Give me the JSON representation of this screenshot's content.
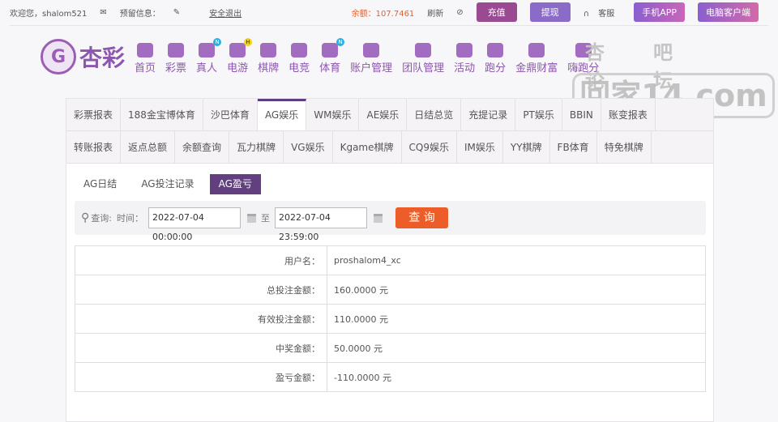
{
  "topbar": {
    "welcome": "欢迎您，shalom521",
    "reserved": "预留信息：",
    "logout": "安全退出",
    "balance": "余额：107.7461",
    "refresh": "刷新",
    "recharge": "充值",
    "withdraw": "提现",
    "service": "客服",
    "app": "手机APP",
    "pc": "电脑客户端"
  },
  "logo": {
    "text": "杏彩",
    "mark": "G"
  },
  "nav": [
    {
      "label": "首页"
    },
    {
      "label": "彩票"
    },
    {
      "label": "真人",
      "badge": "N"
    },
    {
      "label": "电游",
      "badge": "H"
    },
    {
      "label": "棋牌"
    },
    {
      "label": "电竞"
    },
    {
      "label": "体育",
      "badge": "N"
    },
    {
      "label": "账户管理"
    },
    {
      "label": "团队管理"
    },
    {
      "label": "活动"
    },
    {
      "label": "跑分"
    },
    {
      "label": "金鼎财富"
    },
    {
      "label": "嗨跑分"
    }
  ],
  "watermark": {
    "top": "杏吧 论坛",
    "main": "回家14.com"
  },
  "tabs_row1": [
    "彩票报表",
    "188金宝博体育",
    "沙巴体育",
    "AG娱乐",
    "WM娱乐",
    "AE娱乐",
    "日结总览",
    "充提记录",
    "PT娱乐",
    "BBIN",
    "账变报表"
  ],
  "tabs_row2": [
    "转账报表",
    "返点总额",
    "余额查询",
    "瓦力棋牌",
    "VG娱乐",
    "Kgame棋牌",
    "CQ9娱乐",
    "IM娱乐",
    "YY棋牌",
    "FB体育",
    "特免棋牌"
  ],
  "subtabs": [
    "AG日结",
    "AG投注记录",
    "AG盈亏"
  ],
  "search": {
    "query": "查询:",
    "time": "时间：",
    "start": "2022-07-04 00:00:00",
    "to": "至",
    "end": "2022-07-04 23:59:00",
    "button": "查 询"
  },
  "rows": [
    {
      "label": "用户名：",
      "value": "proshalom4_xc"
    },
    {
      "label": "总投注金额：",
      "value": "160.0000 元"
    },
    {
      "label": "有效投注金额：",
      "value": "110.0000 元"
    },
    {
      "label": "中奖金额：",
      "value": "50.0000 元"
    },
    {
      "label": "盈亏金额：",
      "value": "-110.0000 元"
    }
  ]
}
